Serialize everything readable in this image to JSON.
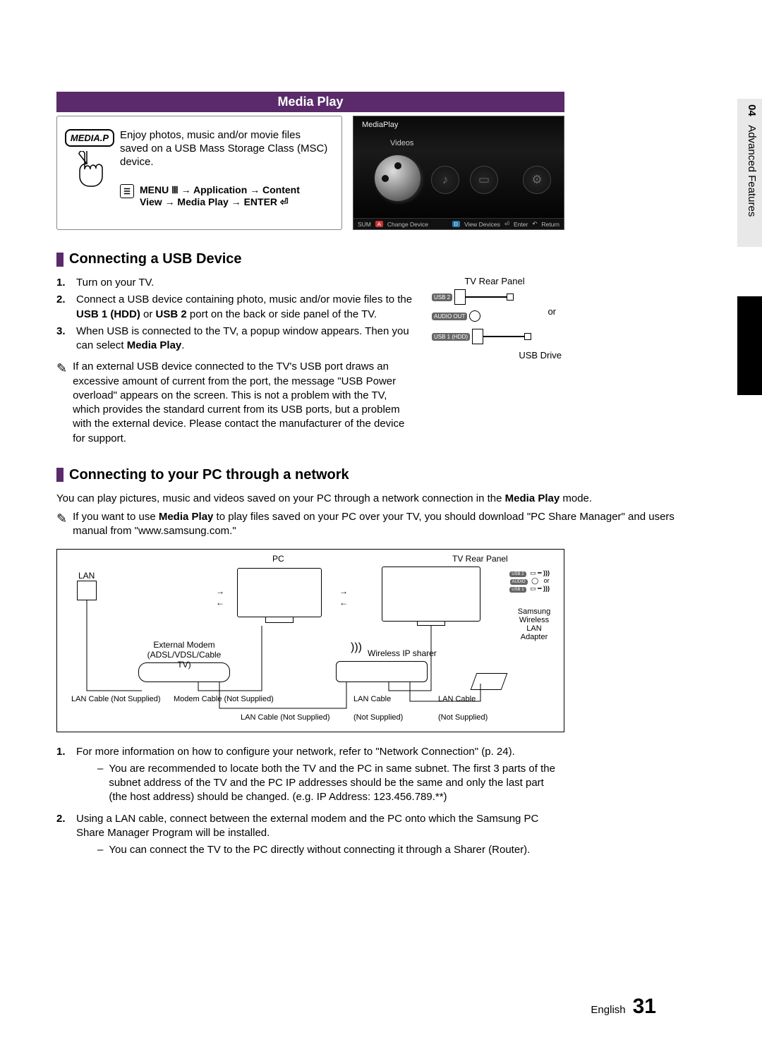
{
  "sidebar": {
    "chapter_num": "04",
    "chapter_title": "Advanced Features"
  },
  "title_bar": "Media Play",
  "remote_label": "MEDIA.P",
  "intro": {
    "desc": "Enjoy photos, music and/or movie files saved on a USB Mass Storage Class (MSC) device.",
    "path_line1": "MENU Ⅲ → Application → Content",
    "path_line2": "View → Media Play → ENTER ⏎"
  },
  "screenshot": {
    "title": "MediaPlay",
    "tab_videos": "Videos",
    "bar_sum": "SUM",
    "bar_change": "Change Device",
    "bar_view": "View Devices",
    "bar_enter": "Enter",
    "bar_return": "Return"
  },
  "section_usb": {
    "heading": "Connecting a USB Device",
    "steps": [
      "Turn on your TV.",
      "Connect a USB device containing photo, music and/or movie files to the USB 1 (HDD) or USB 2 port on the back or side panel of the TV.",
      "When USB is connected to the TV, a popup window appears. Then you can select Media Play."
    ],
    "bold_in_step2a": "USB 1 (HDD)",
    "bold_in_step2b": "USB 2",
    "bold_in_step3": "Media Play",
    "note": "If an external USB device connected to the TV's USB port draws an excessive amount of current from the port, the message \"USB Power overload\" appears on the screen. This is not a problem with the TV, which provides the standard current from its USB ports, but a problem with the external device. Please contact the manufacturer of the device for support.",
    "rear_title": "TV Rear Panel",
    "usb2_lbl": "USB 2",
    "audio_lbl": "AUDIO OUT",
    "usb1_lbl": "USB 1 (HDD)",
    "or": "or",
    "usb_drive": "USB Drive"
  },
  "section_net": {
    "heading": "Connecting to your PC through a network",
    "para": "You can play pictures, music and videos saved on your PC through a network connection in the Media Play mode.",
    "bold_media_play": "Media Play",
    "note": "If you want to use Media Play to play files saved on your PC over your TV, you should download \"PC Share Manager\" and users manual from \"www.samsung.com.\"",
    "diagram": {
      "pc": "PC",
      "tv_rear": "TV Rear Panel",
      "lan": "LAN",
      "ext_modem": "External Modem",
      "ext_modem_sub": "(ADSL/VDSL/Cable TV)",
      "wireless_ip": "Wireless IP sharer",
      "or": "or",
      "samsung_wlan": "Samsung Wireless LAN Adapter",
      "lan_cable_ns": "LAN Cable (Not Supplied)",
      "modem_cable_ns": "Modem Cable (Not Supplied)",
      "lan_cable": "LAN Cable",
      "ns": "(Not Supplied)"
    },
    "steps": [
      "For more information on how to configure your network, refer to \"Network Connection\" (p. 24).",
      "Using a LAN cable, connect between the external modem and the PC onto which the Samsung PC Share Manager Program will be installed."
    ],
    "sub1a": "You are recommended to locate both the TV and the PC in same subnet. The first 3 parts of the subnet address of the TV and the PC IP addresses should be the same and only the last part (the host address) should be changed. (e.g. IP Address: 123.456.789.**)",
    "sub2a": "You can connect the TV to the PC directly without connecting it through a Sharer (Router)."
  },
  "footer": {
    "lang": "English",
    "page": "31"
  }
}
